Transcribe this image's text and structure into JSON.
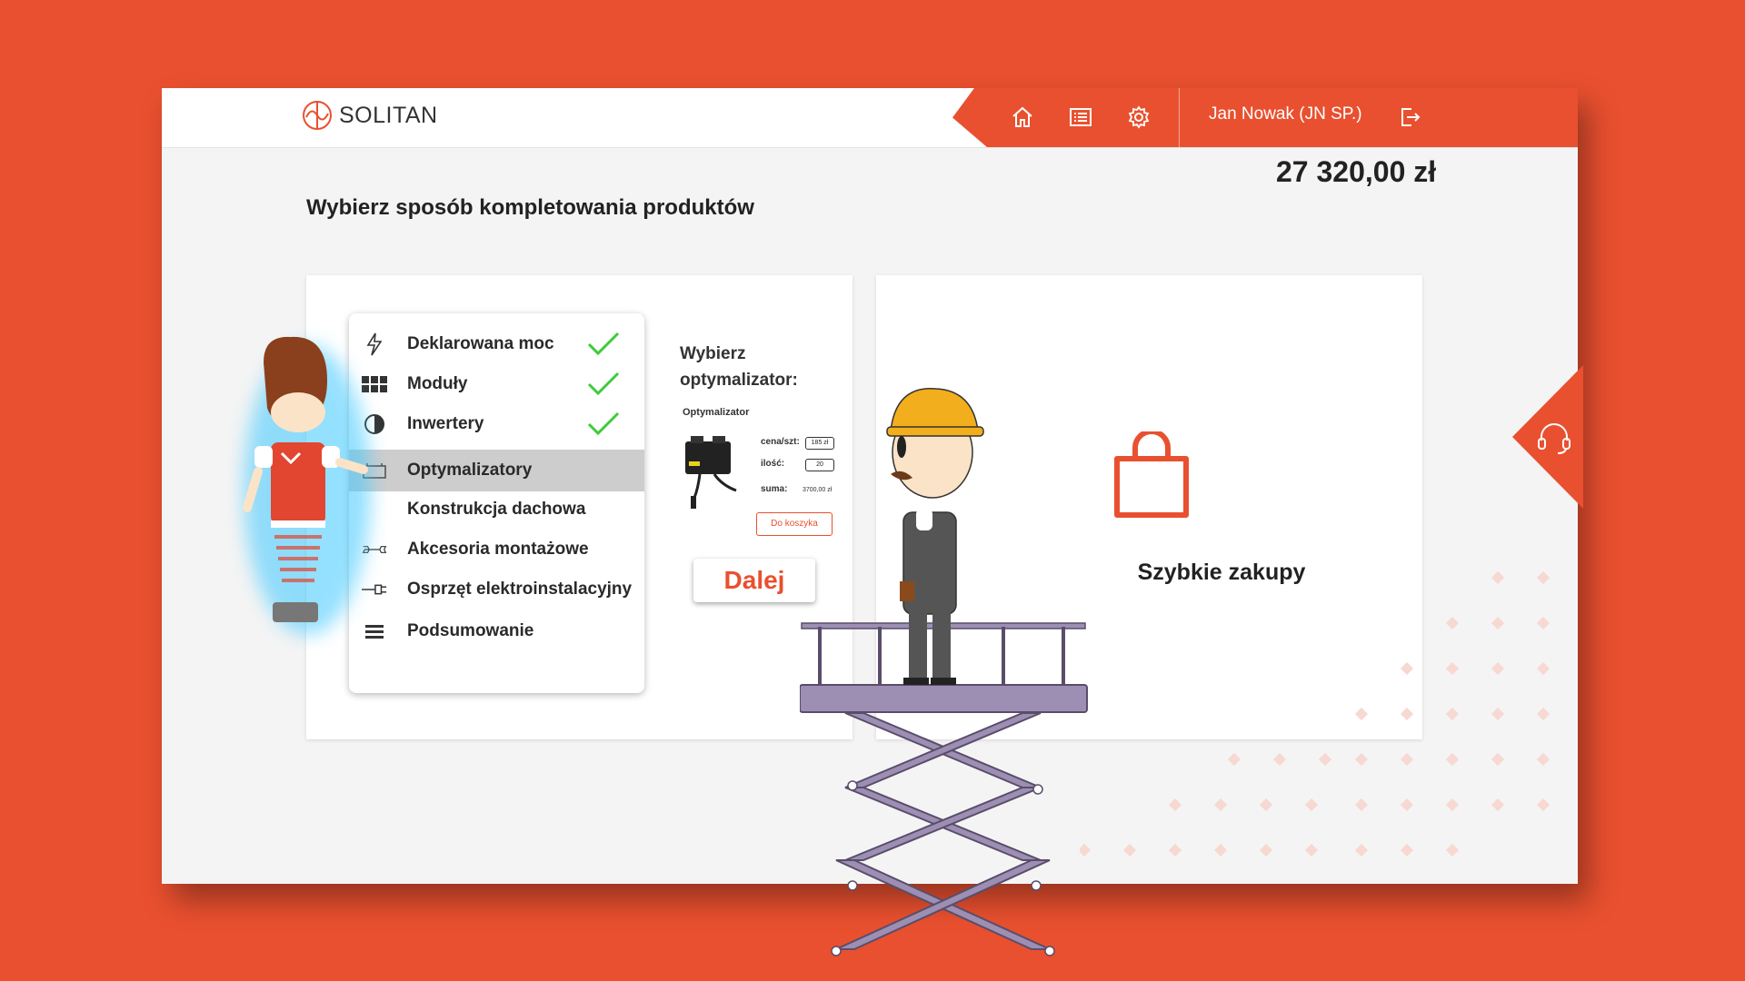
{
  "header": {
    "logo_text": "SOLITAN",
    "user": "Jan Nowak (JN SP.)",
    "nav_icons": [
      "home-icon",
      "list-icon",
      "gear-icon",
      "logout-icon"
    ]
  },
  "cart_total": "27 320,00 zł",
  "page_title": "Wybierz sposób kompletowania produktów",
  "menu": {
    "items": [
      {
        "label": "Deklarowana moc",
        "done": true
      },
      {
        "label": "Moduły",
        "done": true
      },
      {
        "label": "Inwertery",
        "done": true
      },
      {
        "label": "Optymalizatory",
        "done": false,
        "active": true
      },
      {
        "label": "Konstrukcja dachowa",
        "done": false
      },
      {
        "label": "Akcesoria montażowe",
        "done": false
      },
      {
        "label": "Osprzęt elektroinstalacyjny",
        "done": false
      },
      {
        "label": "Podsumowanie",
        "done": false
      }
    ]
  },
  "optimizer": {
    "title": "Wybierz optymalizator:",
    "product_name": "Optymalizator",
    "price_label": "cena/szt:",
    "price_value": "185 zł",
    "qty_label": "ilość:",
    "qty_value": "20",
    "sum_label": "suma:",
    "sum_value": "3700,00 zł",
    "cart_button": "Do koszyka"
  },
  "next_button": "Dalej",
  "quick_buy": {
    "label": "Szybkie zakupy"
  },
  "colors": {
    "accent": "#E9502F",
    "check": "#3DCB3D",
    "active_row": "#CDCDCD"
  }
}
